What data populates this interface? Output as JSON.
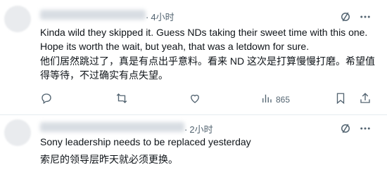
{
  "post1": {
    "timestamp": "4小时",
    "text_line1": "Kinda wild they skipped it. Guess NDs taking their sweet time with this one.",
    "text_line2": "Hope its worth the wait, but yeah, that was a letdown for sure.",
    "translation_line1": "他们居然跳过了，真是有点出乎意料。看来 ND 这次是打算慢慢打磨。希望值",
    "translation_line2": "得等待，不过确实有点失望。",
    "views_count": "865",
    "icons": [
      "grok-icon",
      "more-icon",
      "reply-icon",
      "repost-icon",
      "like-icon",
      "views-icon",
      "bookmark-icon",
      "share-icon"
    ]
  },
  "post2": {
    "timestamp": "2小时",
    "text_line1": "Sony leadership needs to be replaced yesterday",
    "translation_line1": "索尼的领导层昨天就必须更换。",
    "icons": [
      "grok-icon",
      "more-icon"
    ]
  }
}
